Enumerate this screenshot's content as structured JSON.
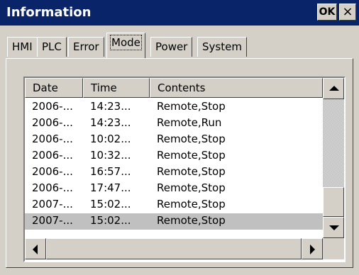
{
  "window": {
    "title": "Information",
    "ok_label": "OK",
    "close_label": "×"
  },
  "tabs": [
    {
      "label": "HMI",
      "active": false
    },
    {
      "label": "PLC",
      "active": false
    },
    {
      "label": "Error",
      "active": false
    },
    {
      "label": "Mode",
      "active": true
    },
    {
      "label": "Power",
      "active": false
    },
    {
      "label": "System",
      "active": false
    }
  ],
  "list": {
    "columns": [
      "Date",
      "Time",
      "Contents"
    ],
    "rows": [
      {
        "date": "2006-...",
        "time": "14:23...",
        "contents": "Remote,Stop"
      },
      {
        "date": "2006-...",
        "time": "14:23...",
        "contents": "Remote,Run"
      },
      {
        "date": "2006-...",
        "time": "10:02...",
        "contents": "Remote,Stop"
      },
      {
        "date": "2006-...",
        "time": "10:32...",
        "contents": "Remote,Stop"
      },
      {
        "date": "2006-...",
        "time": "16:57...",
        "contents": "Remote,Stop"
      },
      {
        "date": "2006-...",
        "time": "17:47...",
        "contents": "Remote,Stop"
      },
      {
        "date": "2007-...",
        "time": "15:02...",
        "contents": "Remote,Stop"
      },
      {
        "date": "2007-...",
        "time": "15:02...",
        "contents": "Remote,Stop"
      }
    ],
    "selected_row": 7
  },
  "colors": {
    "titlebar": "#0a246a",
    "face": "#d4d0c8",
    "selection": "#c0c0c0"
  },
  "icons": {
    "scroll_up": "arrow-up-icon",
    "scroll_down": "arrow-down-icon",
    "scroll_left": "arrow-left-icon",
    "scroll_right": "arrow-right-icon"
  }
}
